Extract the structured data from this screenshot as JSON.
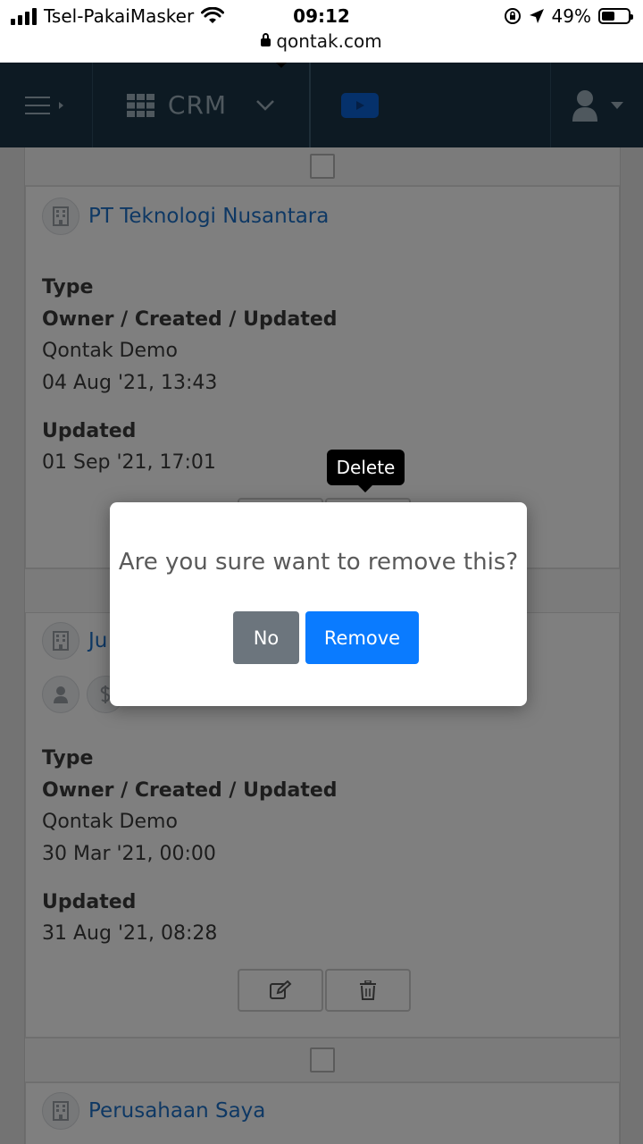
{
  "status_bar": {
    "carrier": "Tsel-PakaiMasker",
    "time": "09:12",
    "url": "qontak.com",
    "battery": "49%",
    "battery_level": 0.49
  },
  "navbar": {
    "module": "CRM"
  },
  "records": [
    {
      "company": "PT Teknologi Nusantara",
      "type_label": "Type",
      "owner_label": "Owner / Created / Updated",
      "owner": "Qontak Demo",
      "created": "04 Aug '21, 13:43",
      "updated_label": "Updated",
      "updated": "01 Sep '21, 17:01"
    },
    {
      "company": "Ju",
      "type_label": "Type",
      "owner_label": "Owner / Created / Updated",
      "owner": "Qontak Demo",
      "created": "30 Mar '21, 00:00",
      "updated_label": "Updated",
      "updated": "31 Aug '21, 08:28"
    },
    {
      "company": "Perusahaan Saya"
    }
  ],
  "tooltip": "Delete",
  "dialog": {
    "message": "Are you sure want to remove this?",
    "no_label": "No",
    "remove_label": "Remove"
  },
  "colors": {
    "navbar": "#1a3547",
    "link": "#1d71c9",
    "remove": "#0a7bff",
    "no": "#6c757d"
  }
}
